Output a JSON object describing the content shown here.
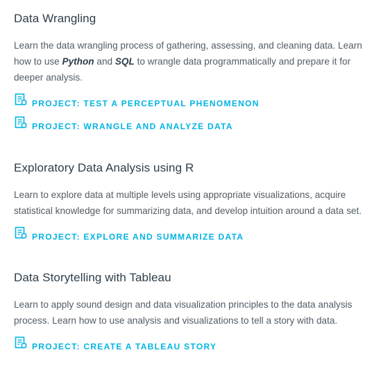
{
  "sections": [
    {
      "title": "Data Wrangling",
      "desc_parts": {
        "a": "Learn the data wrangling process of gathering, assessing, and cleaning data. Learn how to use ",
        "b": "Python",
        "c": " and ",
        "d": "SQL",
        "e": " to wrangle data programmatically and prepare it for deeper analysis."
      },
      "projects": [
        {
          "label": "PROJECT: TEST A PERCEPTUAL PHENOMENON",
          "icon": "project-document-icon"
        },
        {
          "label": "PROJECT: WRANGLE AND ANALYZE DATA",
          "icon": "project-document-icon"
        }
      ]
    },
    {
      "title": "Exploratory Data Analysis using R",
      "desc": "Learn to explore data at multiple levels using appropriate visualizations, acquire statistical knowledge for summarizing data, and develop intuition around a data set.",
      "projects": [
        {
          "label": "PROJECT: EXPLORE AND SUMMARIZE DATA",
          "icon": "project-document-icon"
        }
      ]
    },
    {
      "title": "Data Storytelling with Tableau",
      "desc": "Learn to apply sound design and data visualization principles to the data analysis process. Learn how to use analysis and visualizations to tell a story with data.",
      "projects": [
        {
          "label": "PROJECT: CREATE A TABLEAU STORY",
          "icon": "project-document-icon"
        }
      ]
    }
  ],
  "colors": {
    "title": "#2e3d49",
    "body_text": "#525c65",
    "link": "#02b3e4"
  }
}
